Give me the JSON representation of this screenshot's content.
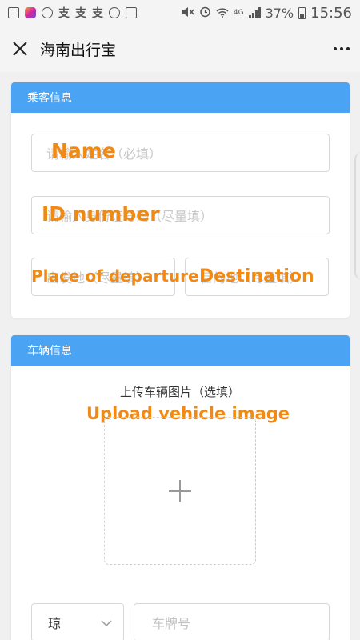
{
  "status_bar": {
    "zhi_glyphs": [
      "支",
      "支",
      "支"
    ],
    "network": "4G",
    "battery": "37%",
    "time": "15:56"
  },
  "title_bar": {
    "title": "海南出行宝"
  },
  "passenger_card": {
    "header": "乘客信息",
    "name_placeholder": "请输入姓名（必填）",
    "name_overlay": "Name",
    "id_placeholder": "请输入身份证号码（尽量填）",
    "id_overlay": "ID number",
    "departure_placeholder": "出发地（尽量填）",
    "departure_overlay": "Place of departure",
    "destination_placeholder": "目的地（尽量填）",
    "destination_overlay": "Destination"
  },
  "vehicle_card": {
    "header": "车辆信息",
    "upload_label": "上传车辆图片（选填）",
    "upload_overlay": "Upload vehicle image",
    "province_value": "琼",
    "plate_placeholder": "车牌号"
  },
  "icons": {
    "close": "close-icon",
    "more": "more-dots-icon",
    "upload": "plus-icon",
    "select": "chevron-down-icon"
  },
  "colors": {
    "header_blue": "#4ba3f3",
    "overlay_orange": "#f08a14"
  }
}
